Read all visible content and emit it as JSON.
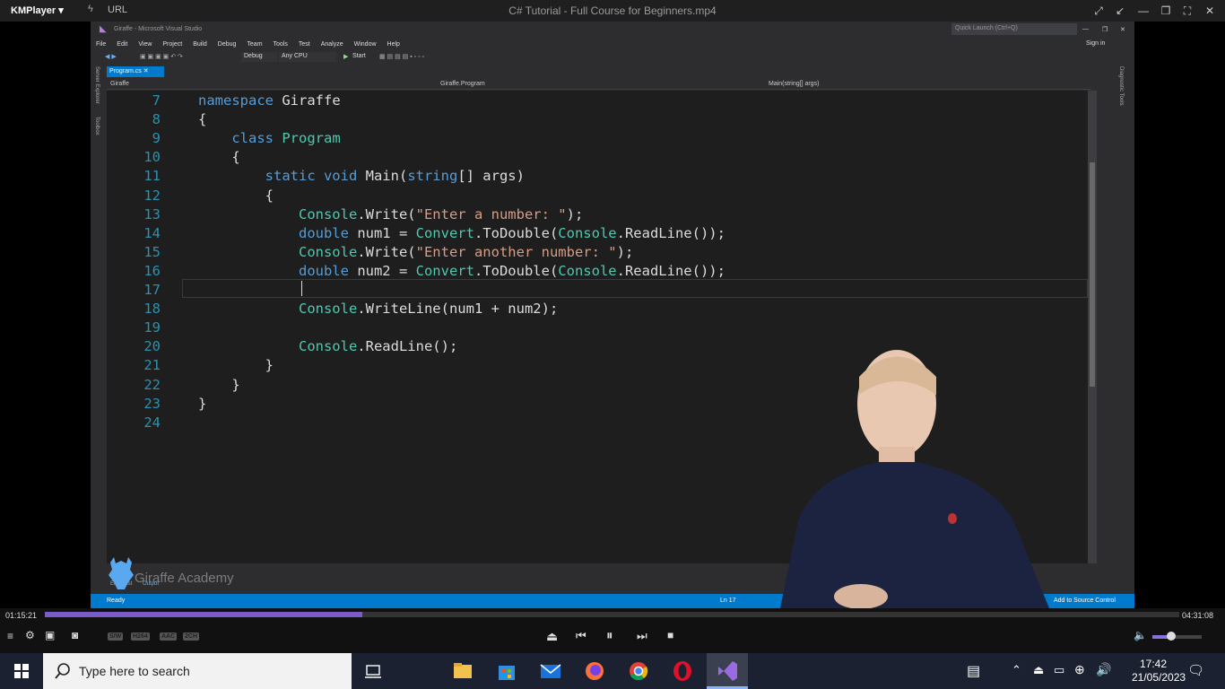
{
  "player": {
    "app_name": "KMPlayer",
    "url_label": "URL",
    "file_title": "C# Tutorial - Full Course for Beginners.mp4"
  },
  "vs": {
    "window_title": "Giraffe - Microsoft Visual Studio",
    "quick_launch": "Quick Launch (Ctrl+Q)",
    "sign_in": "Sign in",
    "menu": [
      "File",
      "Edit",
      "View",
      "Project",
      "Build",
      "Debug",
      "Team",
      "Tools",
      "Test",
      "Analyze",
      "Window",
      "Help"
    ],
    "config": "Debug",
    "platform": "Any CPU",
    "start_label": "Start",
    "tab": "Program.cs",
    "nav_project": "Giraffe",
    "nav_class": "Giraffe.Program",
    "nav_member": "Main(string[] args)",
    "status_left": "Ready",
    "status_ln": "Ln 17",
    "status_right": "Add to Source Control",
    "side_labels": [
      "Server Explorer",
      "Toolbox"
    ],
    "right_labels": [
      "Diagnostic Tools"
    ],
    "bottom_tabs": [
      "Error List",
      "Output"
    ],
    "line_numbers": [
      "7",
      "8",
      "9",
      "10",
      "11",
      "12",
      "13",
      "14",
      "15",
      "16",
      "17",
      "18",
      "19",
      "20",
      "21",
      "22",
      "23",
      "24"
    ],
    "code": {
      "l7_kw": "namespace",
      "l7_rest": " Giraffe",
      "l8": "{",
      "l9_kw": "class",
      "l9_ty": " Program",
      "l10": "{",
      "l11_kw": "static void",
      "l11_rest": " Main(",
      "l11_kw2": "string",
      "l11_rest2": "[] args)",
      "l12": "{",
      "l13_ty": "Console",
      "l13_a": ".Write(",
      "l13_st": "\"Enter a number: \"",
      "l13_b": ");",
      "l14_kw": "double",
      "l14_a": " num1 = ",
      "l14_ty": "Convert",
      "l14_b": ".ToDouble(",
      "l14_ty2": "Console",
      "l14_c": ".ReadLine());",
      "l15_ty": "Console",
      "l15_a": ".Write(",
      "l15_st": "\"Enter another number: \"",
      "l15_b": ");",
      "l16_kw": "double",
      "l16_a": " num2 = ",
      "l16_ty": "Convert",
      "l16_b": ".ToDouble(",
      "l16_ty2": "Console",
      "l16_c": ".ReadLine());",
      "l18_ty": "Console",
      "l18_a": ".WriteLine(num1 + num2);",
      "l20_ty": "Console",
      "l20_a": ".ReadLine();",
      "l21": "}",
      "l22": "}",
      "l23": "}"
    },
    "watermark": "Giraffe Academy"
  },
  "playback": {
    "current_time": "01:15:21",
    "total_time": "04:31:08",
    "progress": 0.28,
    "badges": [
      "S/W",
      "H264",
      "AAC",
      "2CH"
    ],
    "volume": 0.35
  },
  "taskbar": {
    "search_placeholder": "Type here to search",
    "time": "17:42",
    "date": "21/05/2023",
    "apps": [
      "task-view",
      "file-explorer",
      "microsoft-store",
      "mail",
      "firefox",
      "chrome",
      "opera",
      "visual-studio"
    ]
  }
}
